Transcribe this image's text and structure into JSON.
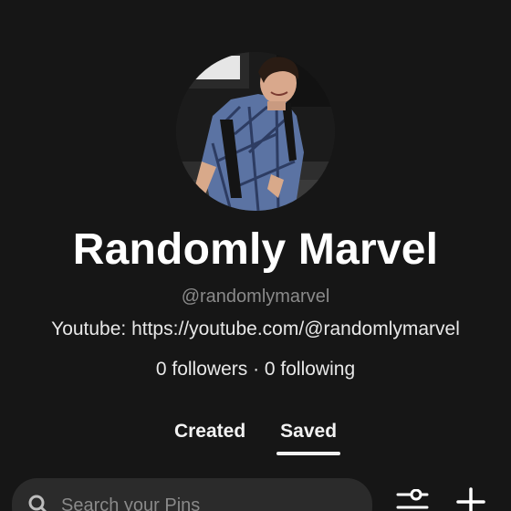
{
  "profile": {
    "name": "Randomly Marvel",
    "handle": "@randomlymarvel",
    "bio": "Youtube: https://youtube.com/@randomlymarvel",
    "stats": "0 followers · 0 following"
  },
  "tabs": [
    {
      "label": "Created",
      "active": false
    },
    {
      "label": "Saved",
      "active": true
    }
  ],
  "search": {
    "placeholder": "Search your Pins",
    "value": ""
  },
  "icons": {
    "search": "search-icon",
    "filter": "filter-sliders-icon",
    "add": "plus-icon"
  },
  "colors": {
    "background": "#161616",
    "search_bg": "#2b2b2b",
    "muted_text": "#8a8a8a"
  }
}
